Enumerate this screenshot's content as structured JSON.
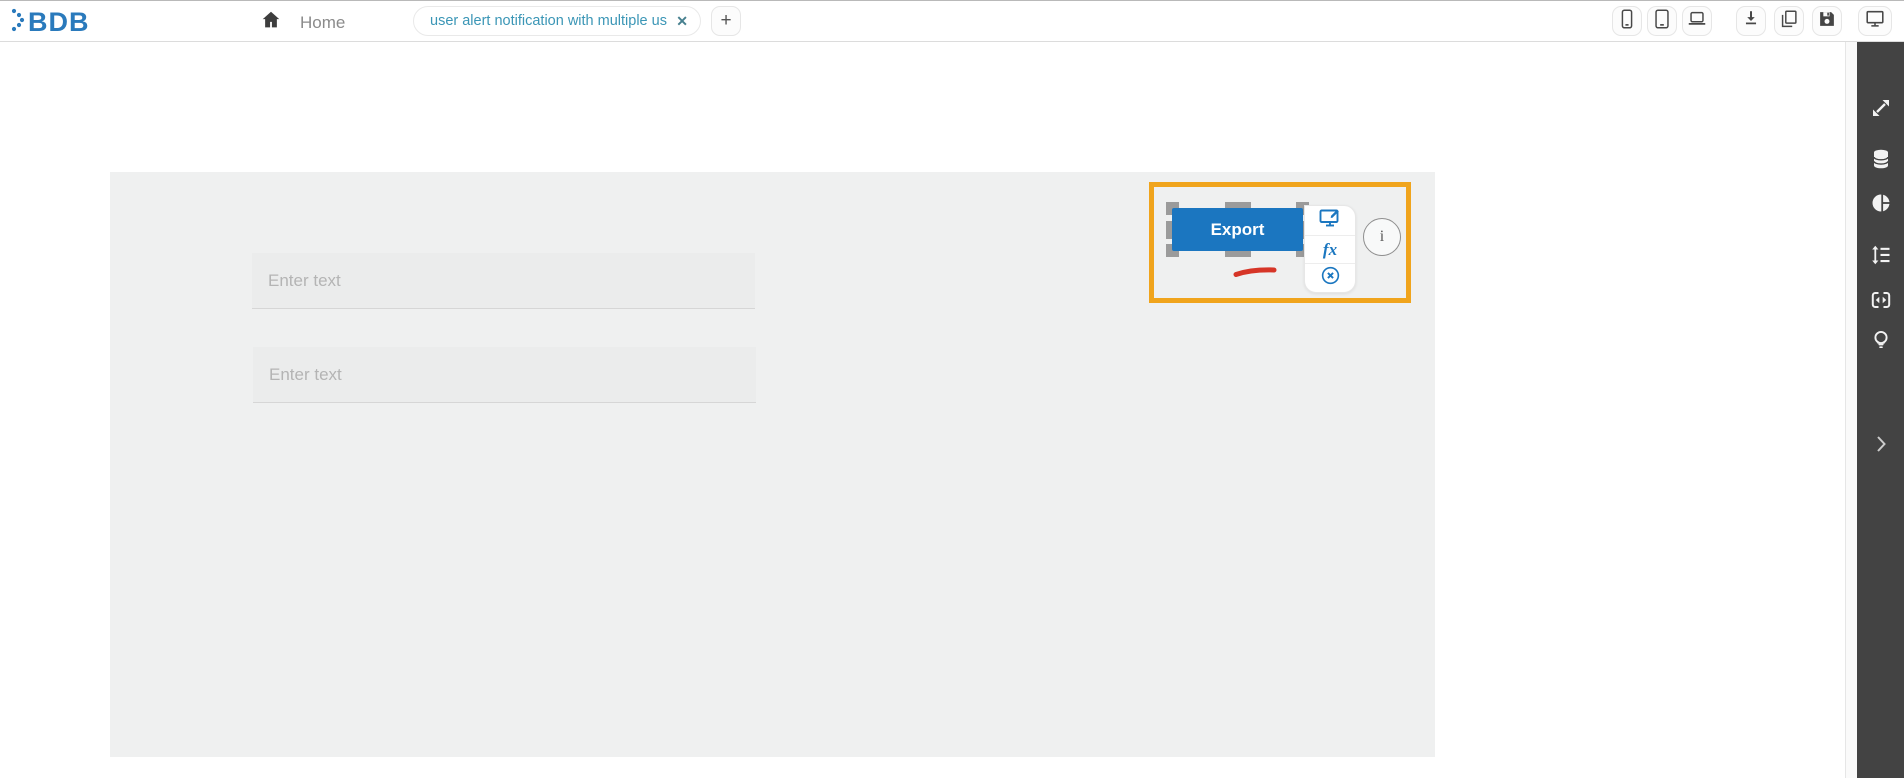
{
  "header": {
    "logo": "BDB",
    "home": "Home",
    "tab_title": "user alert notification with multiple us...",
    "tab_close": "✕",
    "new_tab": "+"
  },
  "canvas": {
    "inputs": [
      {
        "placeholder": "Enter text"
      },
      {
        "placeholder": "Enter text"
      }
    ],
    "export_label": "Export",
    "fx": "fx",
    "info": "i"
  },
  "icons": {
    "header": [
      "home-icon",
      "mobile-icon",
      "tablet-icon",
      "laptop-icon",
      "download-icon",
      "copy-icon",
      "save-icon",
      "monitor-icon"
    ],
    "sidebar": [
      "expand-icon",
      "database-icon",
      "pie-chart-icon",
      "line-spacing-icon",
      "swap-box-icon",
      "lightbulb-icon",
      "chevron-right-icon"
    ],
    "widget_toolbar": [
      "screen-edit-icon",
      "formula-icon",
      "remove-icon"
    ],
    "annotations": [
      "highlight-rectangle",
      "red-underline"
    ]
  },
  "colors": {
    "accent_blue": "#1b76c0",
    "logo_blue": "#2a7abc",
    "tab_teal": "#3b96b6",
    "highlight_orange": "#f0a41c",
    "annotation_red": "#d63527",
    "sidebar_dark": "#434343",
    "canvas_gray": "#eff0f0"
  }
}
